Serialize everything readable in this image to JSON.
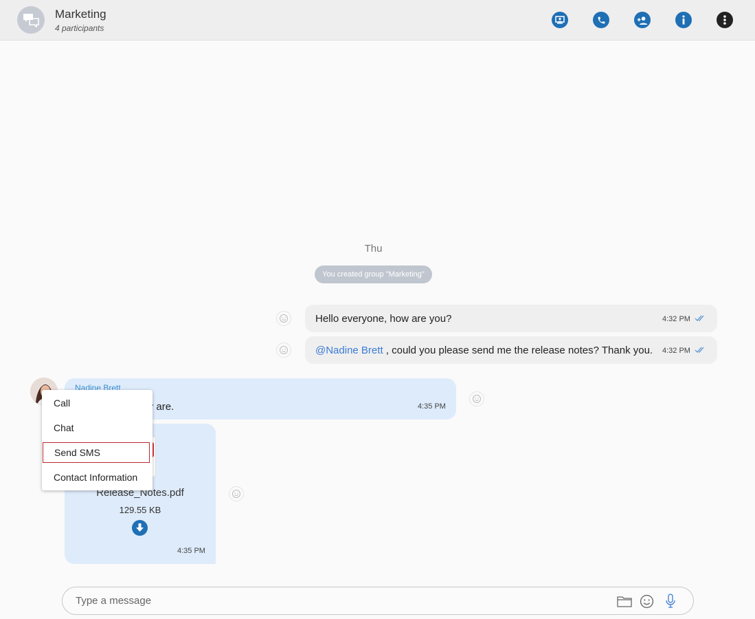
{
  "header": {
    "title": "Marketing",
    "subtitle": "4 participants",
    "actions": [
      "share-screen-icon",
      "phone-icon",
      "add-participant-icon",
      "info-icon",
      "more-options-icon"
    ]
  },
  "chat": {
    "day_label": "Thu",
    "system_message": "You created group \"Marketing\"",
    "outgoing": [
      {
        "text": "Hello everyone, how are you?",
        "time": "4:32 PM"
      },
      {
        "mention": "@Nadine Brett",
        "text": " , could you please send me the release notes? Thank you.",
        "time": "4:32 PM"
      }
    ],
    "incoming": {
      "sender": "Nadine Brett",
      "text_visible": "hey are.",
      "time": "4:35 PM",
      "file": {
        "name": "Release_Notes.pdf",
        "size": "129.55 KB",
        "time": "4:35 PM"
      }
    }
  },
  "context_menu": {
    "items": [
      "Call",
      "Chat",
      "Send SMS",
      "Contact Information"
    ],
    "selected": "Send SMS"
  },
  "composer": {
    "placeholder": "Type a message"
  },
  "colors": {
    "accent": "#1f6fb5",
    "incoming_bubble": "#deebfb",
    "outgoing_bubble": "#efefef",
    "mention": "#3a7bd5",
    "selected_border": "#b7282e"
  }
}
